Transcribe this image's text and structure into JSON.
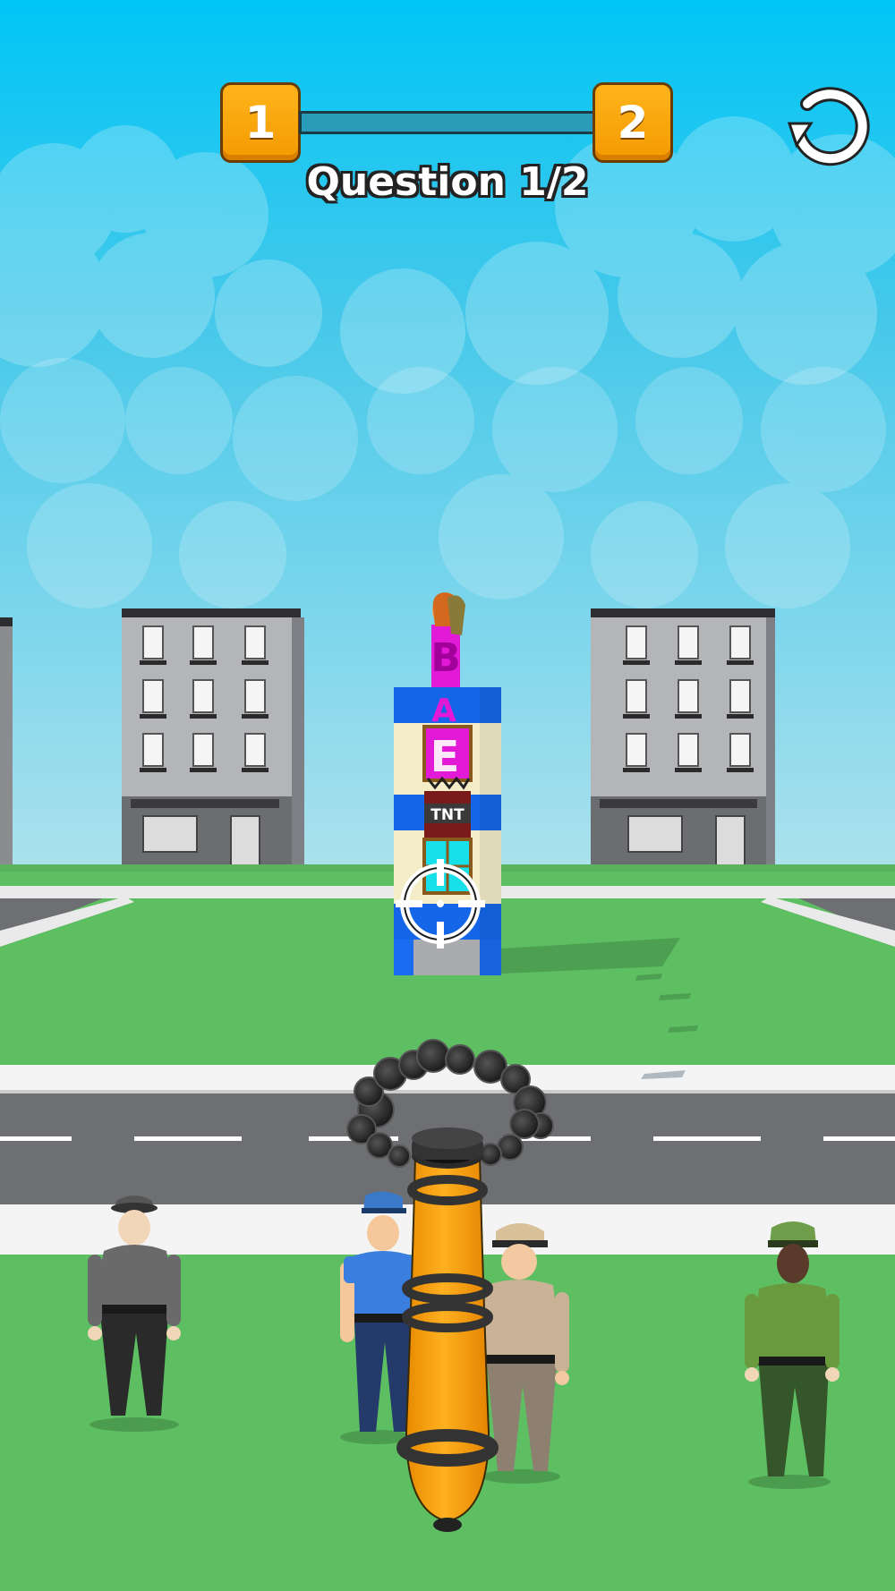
{
  "hud": {
    "current_level": "1",
    "next_level": "2",
    "progress": 0,
    "question_text": "Question 1/2",
    "restart_icon": "restart-icon"
  },
  "scene": {
    "tower_letters": [
      "B",
      "A",
      "E"
    ],
    "tnt_label": "TNT"
  },
  "colors": {
    "sky_top": "#00c4f4",
    "sky_bottom": "#a8e0ec",
    "grass": "#5dbe62",
    "road": "#6d6f73",
    "level_badge": "#f9a10d",
    "cannon": "#ffa500",
    "tower_blue": "#1565e8",
    "letter_magenta": "#e21ad8"
  }
}
